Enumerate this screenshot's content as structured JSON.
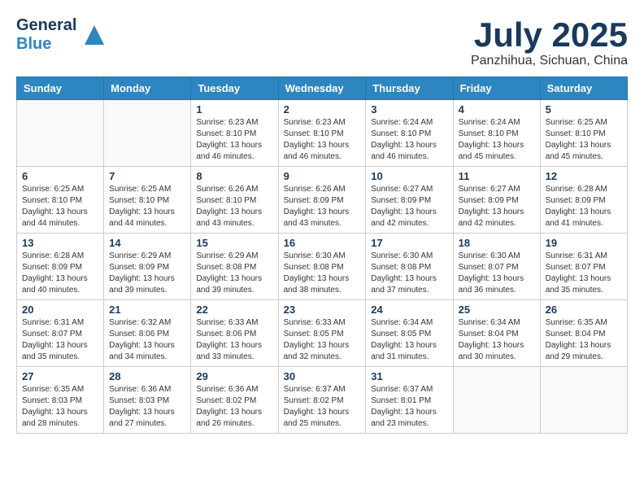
{
  "header": {
    "logo": {
      "general": "General",
      "blue": "Blue",
      "triangle": "▲"
    },
    "title": "July 2025",
    "location": "Panzhihua, Sichuan, China"
  },
  "calendar": {
    "weekdays": [
      "Sunday",
      "Monday",
      "Tuesday",
      "Wednesday",
      "Thursday",
      "Friday",
      "Saturday"
    ],
    "weeks": [
      [
        {
          "day": "",
          "info": ""
        },
        {
          "day": "",
          "info": ""
        },
        {
          "day": "1",
          "info": "Sunrise: 6:23 AM\nSunset: 8:10 PM\nDaylight: 13 hours and 46 minutes."
        },
        {
          "day": "2",
          "info": "Sunrise: 6:23 AM\nSunset: 8:10 PM\nDaylight: 13 hours and 46 minutes."
        },
        {
          "day": "3",
          "info": "Sunrise: 6:24 AM\nSunset: 8:10 PM\nDaylight: 13 hours and 46 minutes."
        },
        {
          "day": "4",
          "info": "Sunrise: 6:24 AM\nSunset: 8:10 PM\nDaylight: 13 hours and 45 minutes."
        },
        {
          "day": "5",
          "info": "Sunrise: 6:25 AM\nSunset: 8:10 PM\nDaylight: 13 hours and 45 minutes."
        }
      ],
      [
        {
          "day": "6",
          "info": "Sunrise: 6:25 AM\nSunset: 8:10 PM\nDaylight: 13 hours and 44 minutes."
        },
        {
          "day": "7",
          "info": "Sunrise: 6:25 AM\nSunset: 8:10 PM\nDaylight: 13 hours and 44 minutes."
        },
        {
          "day": "8",
          "info": "Sunrise: 6:26 AM\nSunset: 8:10 PM\nDaylight: 13 hours and 43 minutes."
        },
        {
          "day": "9",
          "info": "Sunrise: 6:26 AM\nSunset: 8:09 PM\nDaylight: 13 hours and 43 minutes."
        },
        {
          "day": "10",
          "info": "Sunrise: 6:27 AM\nSunset: 8:09 PM\nDaylight: 13 hours and 42 minutes."
        },
        {
          "day": "11",
          "info": "Sunrise: 6:27 AM\nSunset: 8:09 PM\nDaylight: 13 hours and 42 minutes."
        },
        {
          "day": "12",
          "info": "Sunrise: 6:28 AM\nSunset: 8:09 PM\nDaylight: 13 hours and 41 minutes."
        }
      ],
      [
        {
          "day": "13",
          "info": "Sunrise: 6:28 AM\nSunset: 8:09 PM\nDaylight: 13 hours and 40 minutes."
        },
        {
          "day": "14",
          "info": "Sunrise: 6:29 AM\nSunset: 8:09 PM\nDaylight: 13 hours and 39 minutes."
        },
        {
          "day": "15",
          "info": "Sunrise: 6:29 AM\nSunset: 8:08 PM\nDaylight: 13 hours and 39 minutes."
        },
        {
          "day": "16",
          "info": "Sunrise: 6:30 AM\nSunset: 8:08 PM\nDaylight: 13 hours and 38 minutes."
        },
        {
          "day": "17",
          "info": "Sunrise: 6:30 AM\nSunset: 8:08 PM\nDaylight: 13 hours and 37 minutes."
        },
        {
          "day": "18",
          "info": "Sunrise: 6:30 AM\nSunset: 8:07 PM\nDaylight: 13 hours and 36 minutes."
        },
        {
          "day": "19",
          "info": "Sunrise: 6:31 AM\nSunset: 8:07 PM\nDaylight: 13 hours and 35 minutes."
        }
      ],
      [
        {
          "day": "20",
          "info": "Sunrise: 6:31 AM\nSunset: 8:07 PM\nDaylight: 13 hours and 35 minutes."
        },
        {
          "day": "21",
          "info": "Sunrise: 6:32 AM\nSunset: 8:06 PM\nDaylight: 13 hours and 34 minutes."
        },
        {
          "day": "22",
          "info": "Sunrise: 6:33 AM\nSunset: 8:06 PM\nDaylight: 13 hours and 33 minutes."
        },
        {
          "day": "23",
          "info": "Sunrise: 6:33 AM\nSunset: 8:05 PM\nDaylight: 13 hours and 32 minutes."
        },
        {
          "day": "24",
          "info": "Sunrise: 6:34 AM\nSunset: 8:05 PM\nDaylight: 13 hours and 31 minutes."
        },
        {
          "day": "25",
          "info": "Sunrise: 6:34 AM\nSunset: 8:04 PM\nDaylight: 13 hours and 30 minutes."
        },
        {
          "day": "26",
          "info": "Sunrise: 6:35 AM\nSunset: 8:04 PM\nDaylight: 13 hours and 29 minutes."
        }
      ],
      [
        {
          "day": "27",
          "info": "Sunrise: 6:35 AM\nSunset: 8:03 PM\nDaylight: 13 hours and 28 minutes."
        },
        {
          "day": "28",
          "info": "Sunrise: 6:36 AM\nSunset: 8:03 PM\nDaylight: 13 hours and 27 minutes."
        },
        {
          "day": "29",
          "info": "Sunrise: 6:36 AM\nSunset: 8:02 PM\nDaylight: 13 hours and 26 minutes."
        },
        {
          "day": "30",
          "info": "Sunrise: 6:37 AM\nSunset: 8:02 PM\nDaylight: 13 hours and 25 minutes."
        },
        {
          "day": "31",
          "info": "Sunrise: 6:37 AM\nSunset: 8:01 PM\nDaylight: 13 hours and 23 minutes."
        },
        {
          "day": "",
          "info": ""
        },
        {
          "day": "",
          "info": ""
        }
      ]
    ]
  }
}
